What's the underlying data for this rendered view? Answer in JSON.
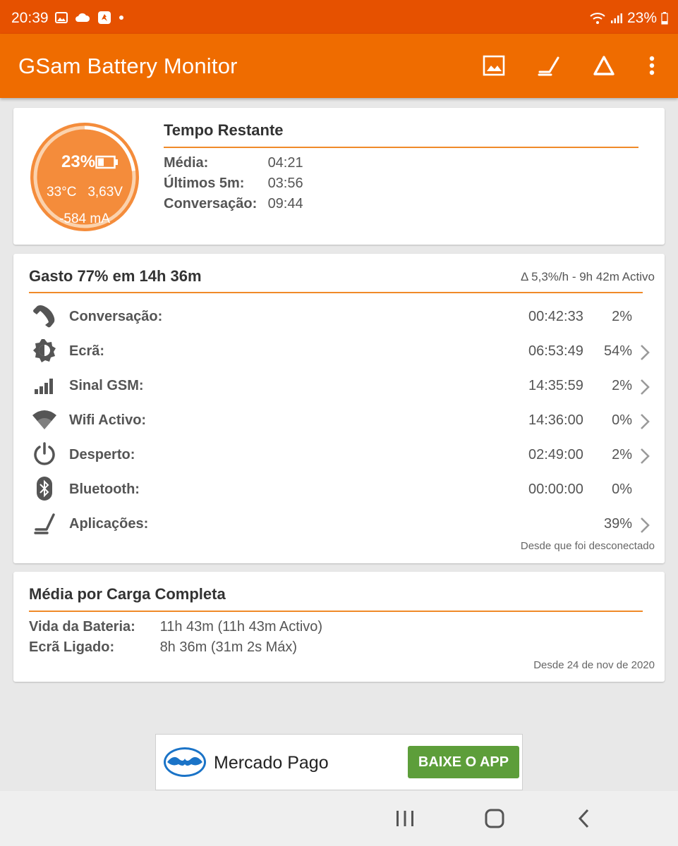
{
  "status_bar": {
    "time": "20:39",
    "battery_pct": "23%"
  },
  "app_bar": {
    "title": "GSam Battery Monitor",
    "actions": [
      "image-icon",
      "app-usage-icon",
      "delta-icon",
      "more-vert-icon"
    ]
  },
  "gauge": {
    "level_pct": "23%",
    "level_fraction": 0.23,
    "temperature": "33°C",
    "voltage": "3,63V",
    "current": "-584 mA"
  },
  "time_remaining": {
    "title": "Tempo Restante",
    "rows": [
      {
        "label": "Média:",
        "value": "04:21"
      },
      {
        "label": "Últimos 5m:",
        "value": "03:56"
      },
      {
        "label": "Conversação:",
        "value": "09:44"
      }
    ]
  },
  "usage": {
    "title": "Gasto 77% em 14h 36m",
    "rate": "Δ 5,3%/h - 9h 42m Activo",
    "rows": [
      {
        "icon": "phone-icon",
        "label": "Conversação:",
        "time": "00:42:33",
        "pct": "2%",
        "chevron": false
      },
      {
        "icon": "brightness-icon",
        "label": "Ecrã:",
        "time": "06:53:49",
        "pct": "54%",
        "chevron": true
      },
      {
        "icon": "signal-bars-icon",
        "label": "Sinal GSM:",
        "time": "14:35:59",
        "pct": "2%",
        "chevron": true
      },
      {
        "icon": "wifi-icon",
        "label": "Wifi Activo:",
        "time": "14:36:00",
        "pct": "0%",
        "chevron": true
      },
      {
        "icon": "power-icon",
        "label": "Desperto:",
        "time": "02:49:00",
        "pct": "2%",
        "chevron": true
      },
      {
        "icon": "bluetooth-icon",
        "label": "Bluetooth:",
        "time": "00:00:00",
        "pct": "0%",
        "chevron": false
      },
      {
        "icon": "apps-icon",
        "label": "Aplicações:",
        "time": "",
        "pct": "39%",
        "chevron": true
      }
    ],
    "footnote": "Desde que foi desconectado"
  },
  "full_charge": {
    "title": "Média por Carga Completa",
    "rows": [
      {
        "label": "Vida da Bateria:",
        "value": "11h 43m (11h 43m Activo)"
      },
      {
        "label": "Ecrã Ligado:",
        "value": "8h 36m (31m 2s Máx)"
      }
    ],
    "footnote": "Desde 24 de nov de 2020"
  },
  "ad": {
    "name": "Mercado Pago",
    "button": "BAIXE O APP"
  },
  "colors": {
    "status_bar": "#e65100",
    "app_bar": "#ef6c00",
    "accent": "#f08a28",
    "gauge_fill": "#f48c3b",
    "ad_button": "#5d9e3a"
  }
}
